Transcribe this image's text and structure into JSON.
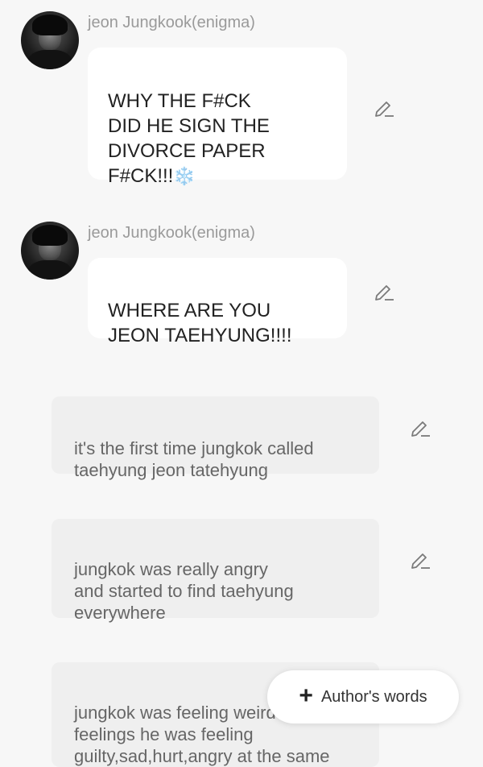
{
  "messages": [
    {
      "author": "jeon Jungkook(enigma)",
      "text": "WHY THE F#CK\nDID HE SIGN THE\nDIVORCE PAPER\nF#CK!!!",
      "emoji": "❄️"
    },
    {
      "author": "jeon Jungkook(enigma)",
      "text": "WHERE ARE YOU\nJEON TAEHYUNG!!!!"
    }
  ],
  "narrations": [
    {
      "text": "it's the first time jungkok called\ntaehyung jeon tatehyung"
    },
    {
      "text": "jungkok was really angry\nand started to find taehyung\neverywhere"
    },
    {
      "text": "jungkok was feeling weird\nfeelings he was feeling\nguilty,sad,hurt,angry at the same"
    }
  ],
  "author_words_button": {
    "label": "Author's words",
    "icon": "plus-icon"
  },
  "icons": {
    "edit": "pencil-icon"
  }
}
